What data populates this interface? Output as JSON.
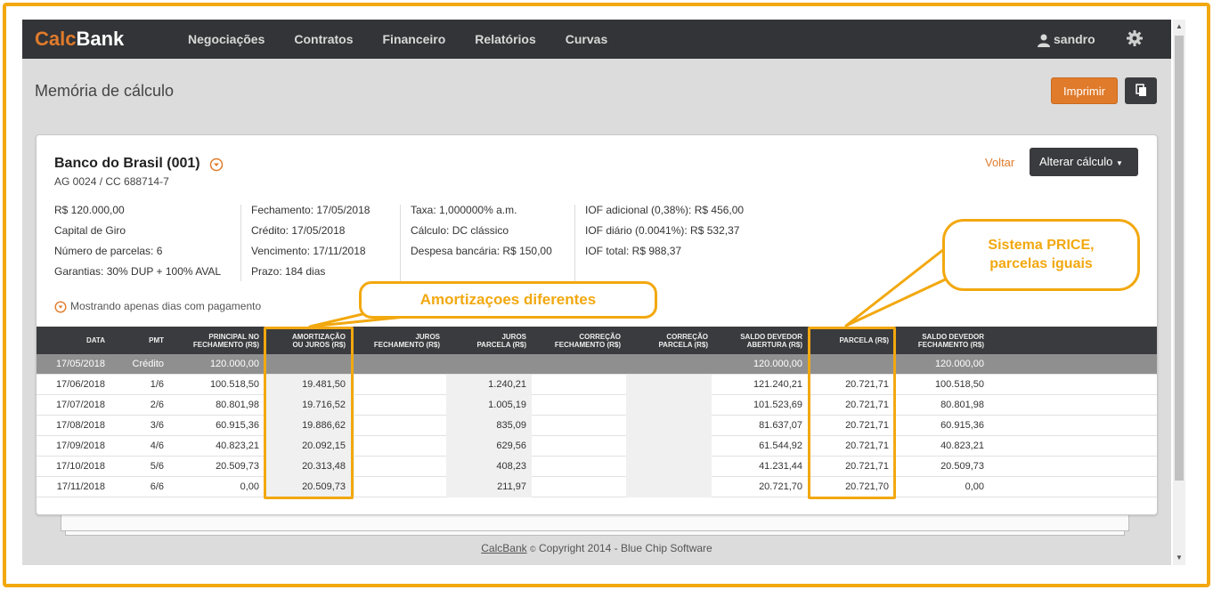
{
  "nav": {
    "brand_a": "Calc",
    "brand_b": "Bank",
    "links": [
      "Negociações",
      "Contratos",
      "Financeiro",
      "Relatórios",
      "Curvas"
    ],
    "user": "sandro"
  },
  "page": {
    "title": "Memória de cálculo",
    "print_label": "Imprimir"
  },
  "card": {
    "bank_name": "Banco do Brasil (001)",
    "account": "AG 0024 / CC 688714-7",
    "back_label": "Voltar",
    "change_label": "Alterar cálculo",
    "col1": [
      "R$ 120.000,00",
      "Capital de Giro",
      "Número de parcelas: 6",
      "Garantias: 30% DUP + 100% AVAL"
    ],
    "col2": [
      "Fechamento: 17/05/2018",
      "Crédito: 17/05/2018",
      "Vencimento: 17/11/2018",
      "Prazo: 184 dias"
    ],
    "col3": [
      "Taxa: 1,000000% a.m.",
      "Cálculo: DC clássico",
      "Despesa bancária: R$ 150,00"
    ],
    "col4": [
      "IOF adicional (0,38%): R$ 456,00",
      "IOF diário (0.0041%): R$ 532,37",
      "IOF total: R$ 988,37"
    ],
    "showing": "Mostrando apenas dias com pagamento"
  },
  "table": {
    "headers": [
      [
        "DATA"
      ],
      [
        "PMT"
      ],
      [
        "PRINCIPAL NO",
        "FECHAMENTO (R$)"
      ],
      [
        "AMORTIZAÇÃO",
        "OU JUROS (R$)"
      ],
      [
        "JUROS",
        "FECHAMENTO (R$)"
      ],
      [
        "JUROS",
        "PARCELA (R$)"
      ],
      [
        "CORREÇÃO",
        "FECHAMENTO (R$)"
      ],
      [
        "CORREÇÃO",
        "PARCELA (R$)"
      ],
      [
        "SALDO DEVEDOR",
        "ABERTURA (R$)"
      ],
      [
        "PARCELA (R$)"
      ],
      [
        "SALDO DEVEDOR",
        "FECHAMENTO (R$)"
      ]
    ],
    "rows": [
      [
        "17/05/2018",
        "Crédito",
        "120.000,00",
        "",
        "",
        "",
        "",
        "",
        "120.000,00",
        "",
        "120.000,00"
      ],
      [
        "17/06/2018",
        "1/6",
        "100.518,50",
        "19.481,50",
        "",
        "1.240,21",
        "",
        "",
        "121.240,21",
        "20.721,71",
        "100.518,50"
      ],
      [
        "17/07/2018",
        "2/6",
        "80.801,98",
        "19.716,52",
        "",
        "1.005,19",
        "",
        "",
        "101.523,69",
        "20.721,71",
        "80.801,98"
      ],
      [
        "17/08/2018",
        "3/6",
        "60.915,36",
        "19.886,62",
        "",
        "835,09",
        "",
        "",
        "81.637,07",
        "20.721,71",
        "60.915,36"
      ],
      [
        "17/09/2018",
        "4/6",
        "40.823,21",
        "20.092,15",
        "",
        "629,56",
        "",
        "",
        "61.544,92",
        "20.721,71",
        "40.823,21"
      ],
      [
        "17/10/2018",
        "5/6",
        "20.509,73",
        "20.313,48",
        "",
        "408,23",
        "",
        "",
        "41.231,44",
        "20.721,71",
        "20.509,73"
      ],
      [
        "17/11/2018",
        "6/6",
        "0,00",
        "20.509,73",
        "",
        "211,97",
        "",
        "",
        "20.721,70",
        "20.721,70",
        "0,00"
      ]
    ]
  },
  "annotations": {
    "left": "Amortizaçoes diferentes",
    "right_1": "Sistema PRICE,",
    "right_2": "parcelas iguais"
  },
  "footer": {
    "link": "CalcBank",
    "rest": "Copyright 2014 - Blue Chip Software",
    "symbol": "©"
  },
  "colors": {
    "accent": "#e07b2b",
    "highlight": "#f2a80f",
    "navbar": "#333437"
  }
}
